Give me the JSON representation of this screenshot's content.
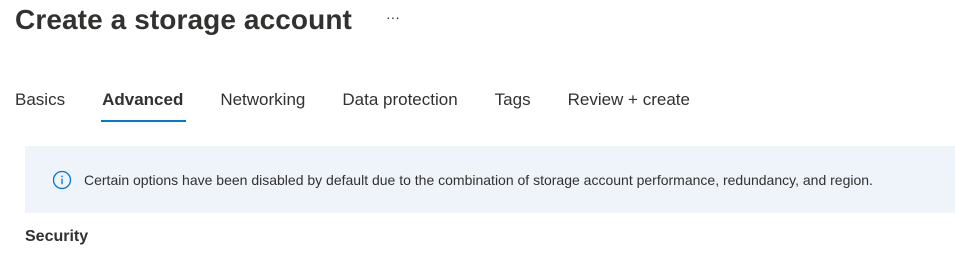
{
  "header": {
    "title": "Create a storage account",
    "more_icon": "ellipsis-icon",
    "more_label": "···"
  },
  "tabs": [
    {
      "label": "Basics",
      "active": false
    },
    {
      "label": "Advanced",
      "active": true
    },
    {
      "label": "Networking",
      "active": false
    },
    {
      "label": "Data protection",
      "active": false
    },
    {
      "label": "Tags",
      "active": false
    },
    {
      "label": "Review + create",
      "active": false
    }
  ],
  "banner": {
    "icon": "info-icon",
    "text": "Certain options have been disabled by default due to the combination of storage account performance, redundancy, and region."
  },
  "section": {
    "title": "Security"
  },
  "colors": {
    "accent": "#0078d4",
    "banner_bg": "#eff4fb",
    "text": "#323130"
  }
}
